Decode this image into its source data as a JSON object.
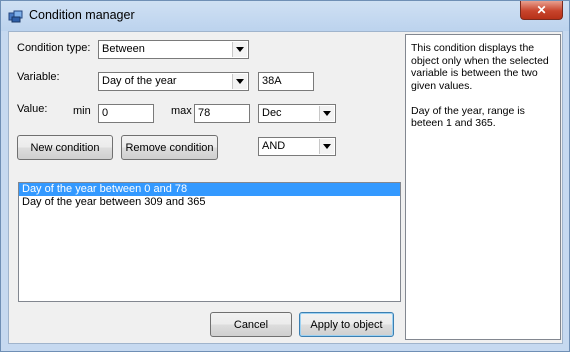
{
  "window": {
    "title": "Condition manager",
    "close_label": "✕"
  },
  "form": {
    "condition_type_label": "Condition type:",
    "condition_type_value": "Between",
    "variable_label": "Variable:",
    "variable_value": "Day of the year",
    "variable_code": "38A",
    "value_label": "Value:",
    "min_label": "min",
    "min_value": "0",
    "max_label": "max",
    "max_value": "78",
    "max_unit": "Dec",
    "new_condition_label": "New condition",
    "remove_condition_label": "Remove condition",
    "logic_value": "AND"
  },
  "conditions": [
    "Day of the year between 0 and 78",
    "Day of the year between 309 and 365"
  ],
  "help": {
    "paragraph1": "This condition displays the object only when the selected variable is between the two given values.",
    "paragraph2": "Day of the year, range is beteen 1 and 365."
  },
  "footer": {
    "cancel_label": "Cancel",
    "apply_label": "Apply to object"
  }
}
